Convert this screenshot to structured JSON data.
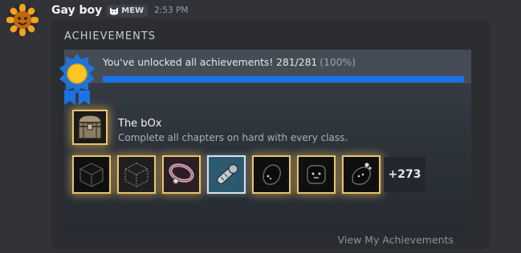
{
  "message": {
    "username": "Gay boy",
    "clan_tag": "MEW",
    "timestamp": "2:53 PM"
  },
  "embed": {
    "title": "ACHIEVEMENTS",
    "banner_text": "You've unlocked all achievements! 281/281",
    "banner_pct": "(100%)",
    "progress": 1.0,
    "featured": {
      "name": "The bOx",
      "description": "Complete all chapters on hard with every class."
    },
    "badges": [
      {
        "icon": "black-cube-icon"
      },
      {
        "icon": "wireframe-cube-icon"
      },
      {
        "icon": "pink-collar-icon"
      },
      {
        "icon": "arm-bone-icon"
      },
      {
        "icon": "black-blob-face-icon"
      },
      {
        "icon": "black-square-face-icon"
      },
      {
        "icon": "black-crying-blob-icon"
      }
    ],
    "more_count": "+273",
    "view_link": "View My Achievements"
  },
  "colors": {
    "accent_blue": "#1a73e8",
    "gold": "#e8c66a"
  }
}
